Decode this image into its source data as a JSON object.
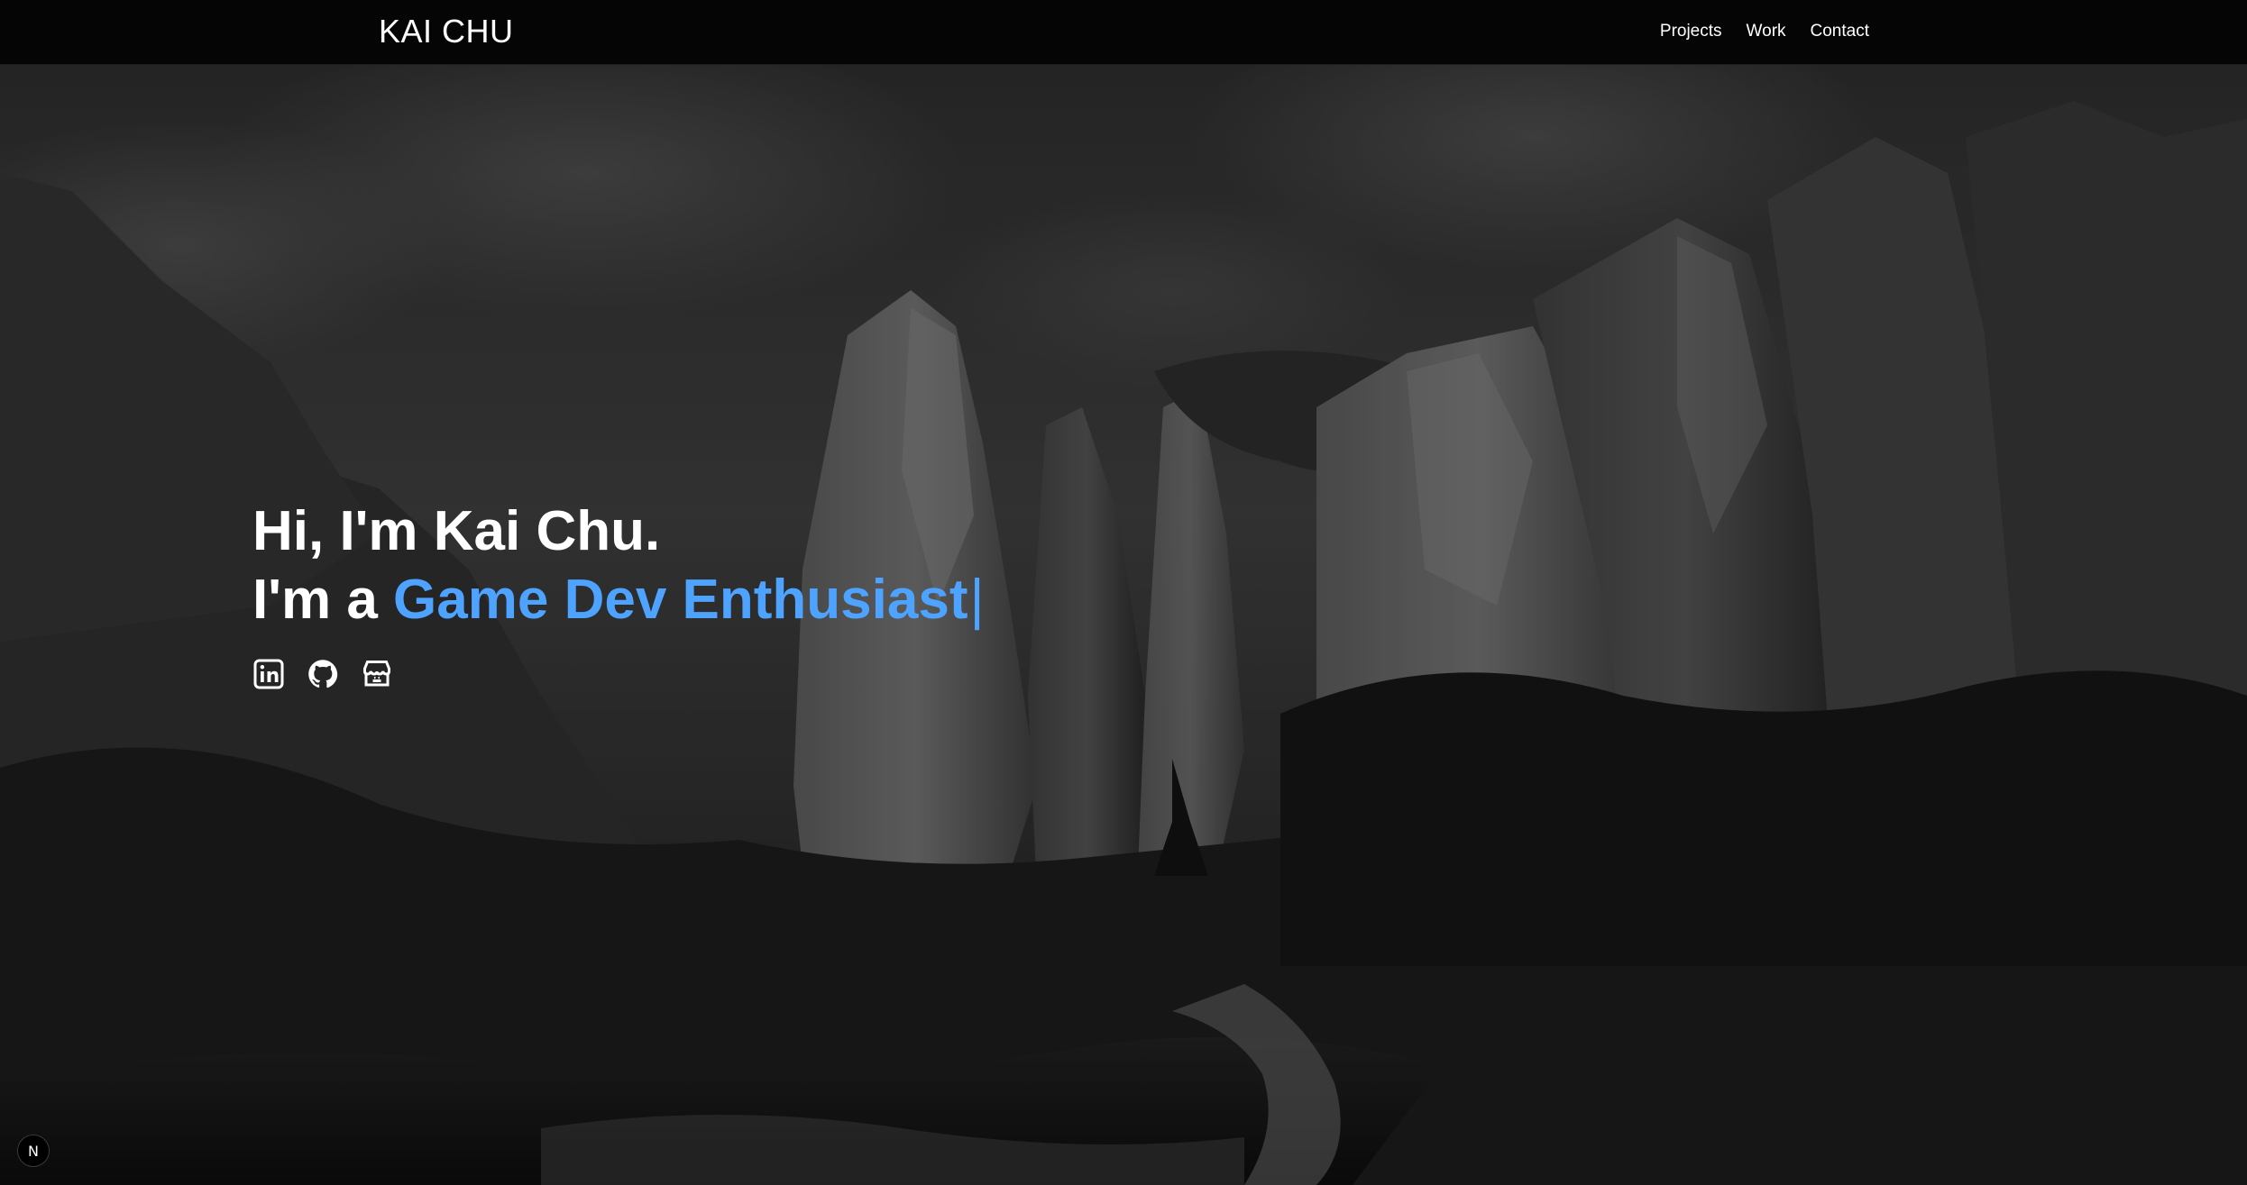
{
  "header": {
    "brand": "KAI CHU",
    "nav": [
      {
        "label": "Projects"
      },
      {
        "label": "Work"
      },
      {
        "label": "Contact"
      }
    ]
  },
  "hero": {
    "line1": "Hi, I'm Kai Chu.",
    "line2_prefix": "I'm a ",
    "line2_highlight": "Game Dev Enthusiast",
    "cursor": "|",
    "accent_color": "#4da3ff",
    "background": "dark grayscale canyon landscape illustration",
    "socials": [
      {
        "icon": "linkedin-icon"
      },
      {
        "icon": "github-icon"
      },
      {
        "icon": "itchio-icon"
      }
    ]
  },
  "dev_badge": {
    "letter": "N"
  }
}
